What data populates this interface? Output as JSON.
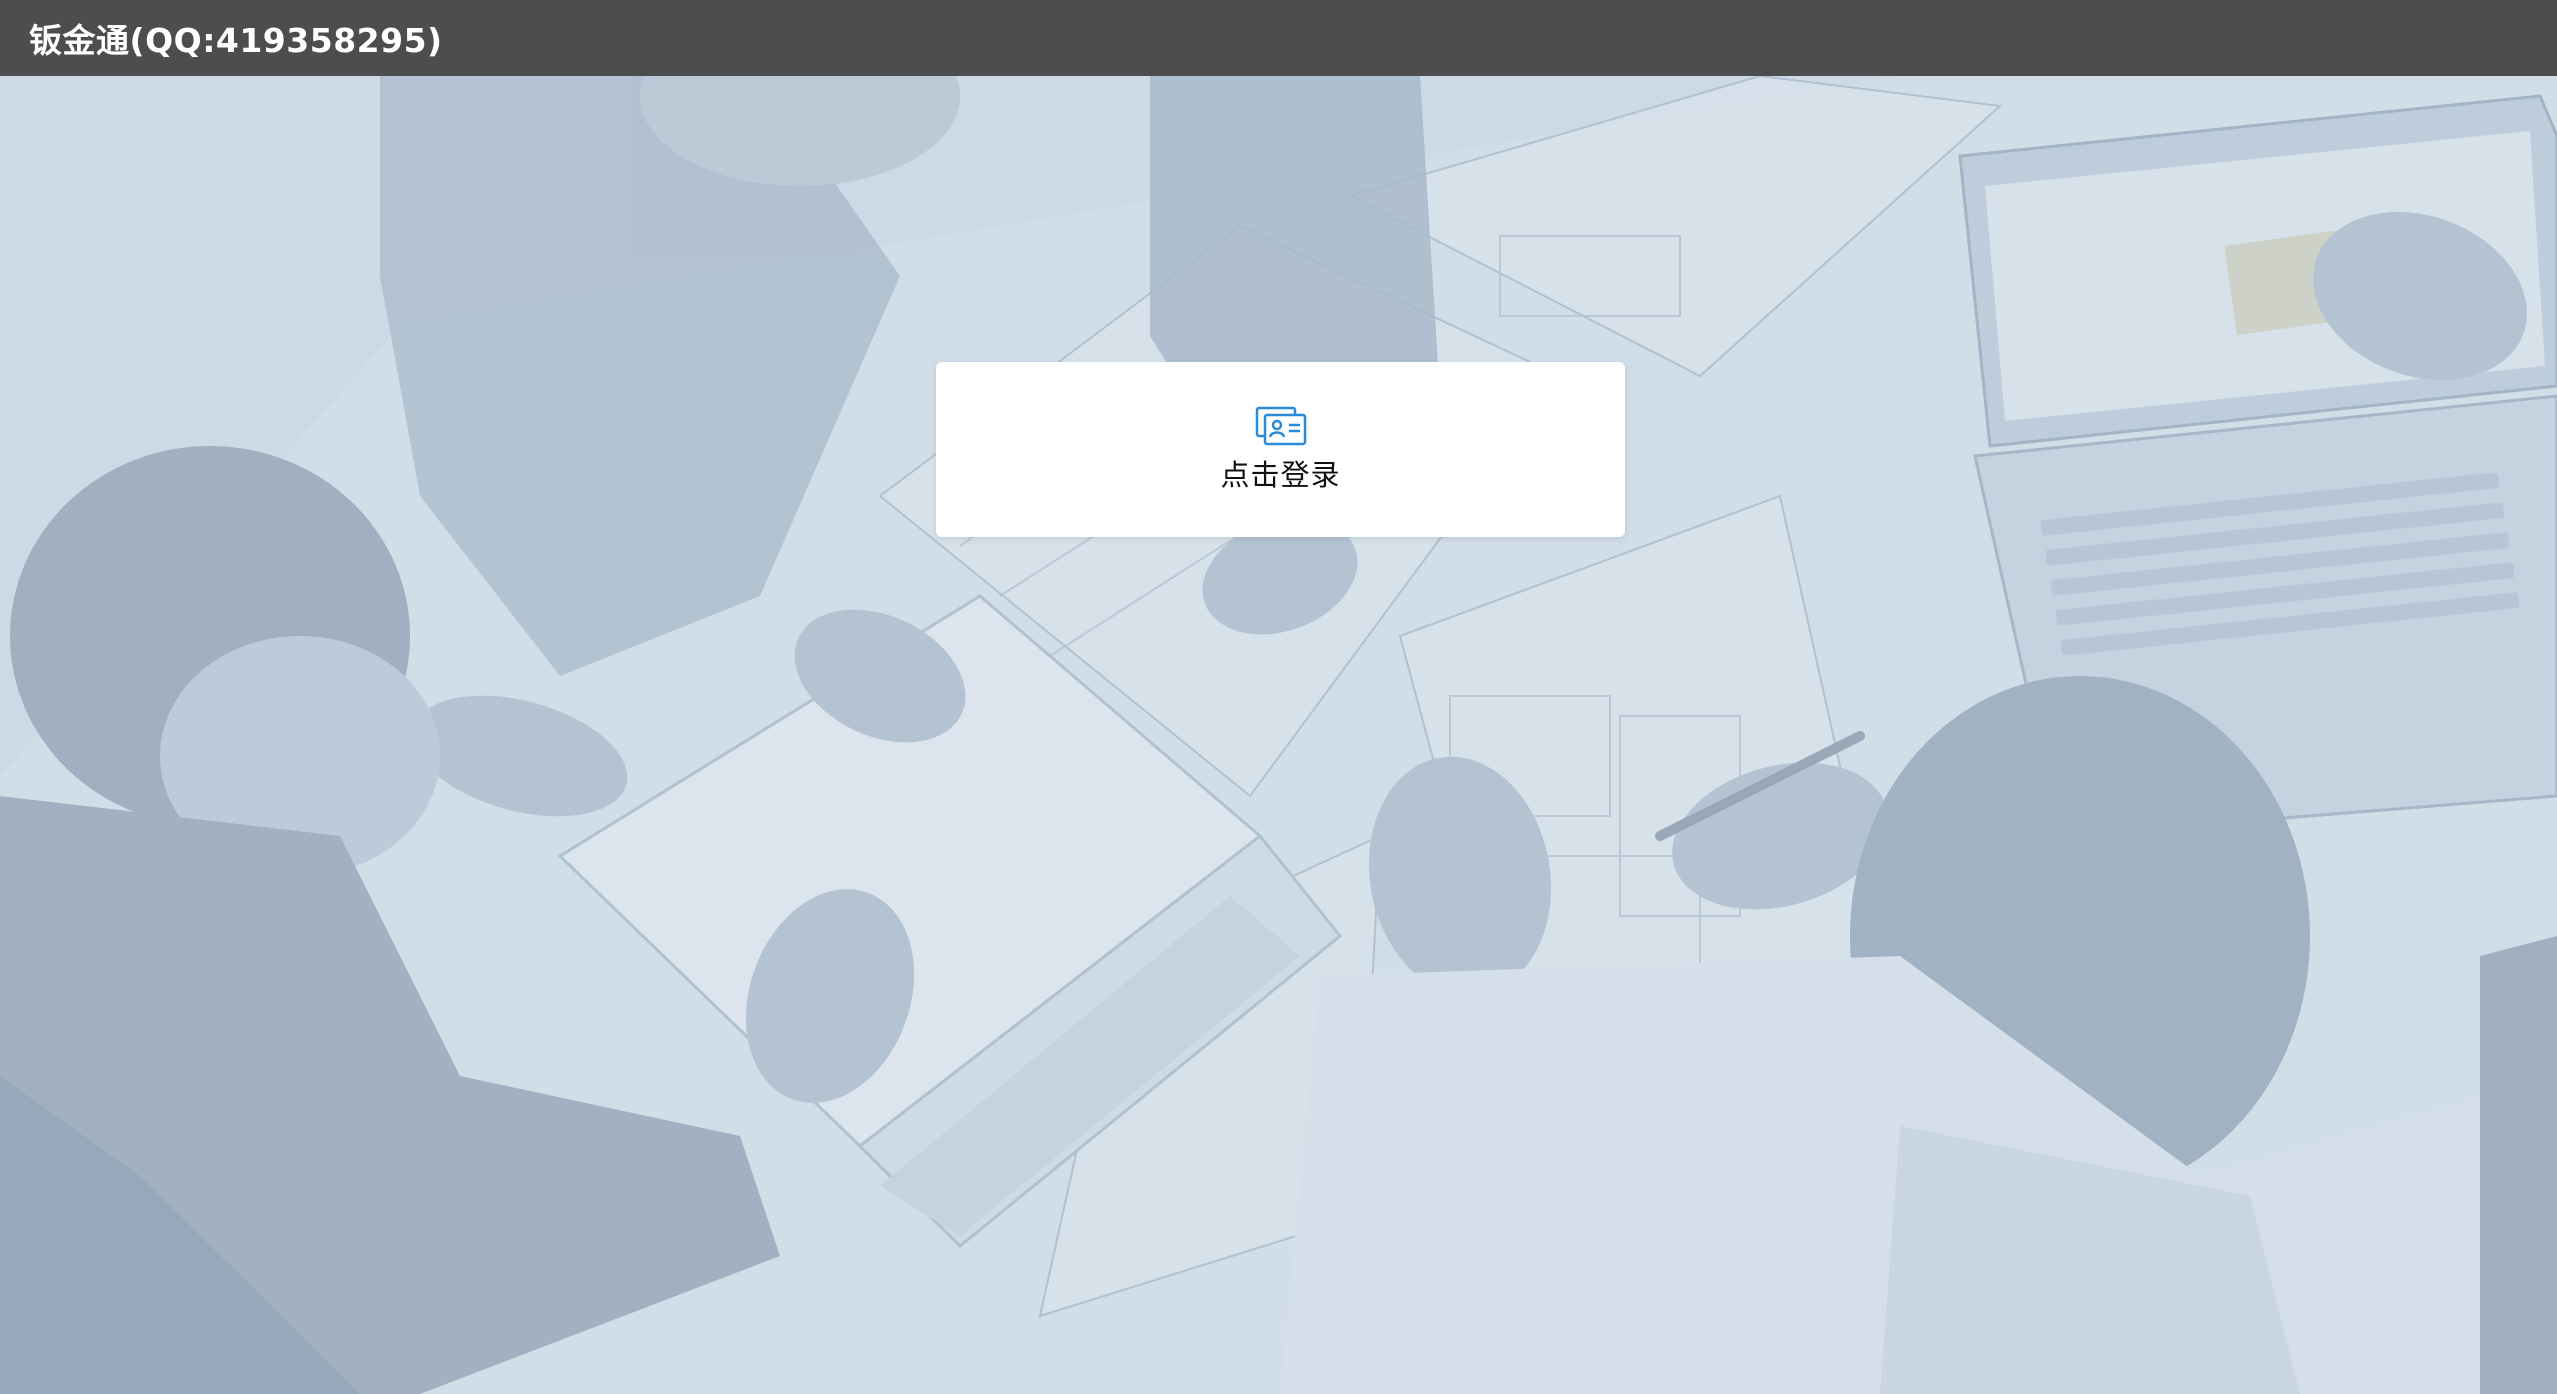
{
  "window": {
    "title": "钣金通(QQ:419358295)"
  },
  "login": {
    "label": "点击登录",
    "icon": "id-card-icon",
    "icon_color": "#2a8bd8"
  },
  "colors": {
    "titlebar": "#4d4d4d",
    "title_text": "#ffffff",
    "card": "#ffffff",
    "overlay": "#c9d6e3"
  }
}
